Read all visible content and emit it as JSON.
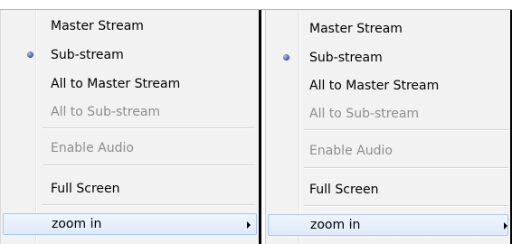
{
  "menus": [
    {
      "items": [
        {
          "label": "Master Stream",
          "enabled": true,
          "selected": false
        },
        {
          "label": "Sub-stream",
          "enabled": true,
          "selected": true
        },
        {
          "label": "All to Master Stream",
          "enabled": true,
          "selected": false
        },
        {
          "label": "All to Sub-stream",
          "enabled": false,
          "selected": false
        },
        {
          "label": "Enable Audio",
          "enabled": false,
          "selected": false
        },
        {
          "label": "Full Screen",
          "enabled": true,
          "selected": false
        },
        {
          "label": "zoom in",
          "enabled": true,
          "selected": false,
          "highlighted": true,
          "has_submenu": true
        }
      ]
    },
    {
      "items": [
        {
          "label": "Master Stream",
          "enabled": true,
          "selected": false
        },
        {
          "label": "Sub-stream",
          "enabled": true,
          "selected": true
        },
        {
          "label": "All to Master Stream",
          "enabled": true,
          "selected": false
        },
        {
          "label": "All to Sub-stream",
          "enabled": false,
          "selected": false
        },
        {
          "label": "Enable Audio",
          "enabled": false,
          "selected": false
        },
        {
          "label": "Full Screen",
          "enabled": true,
          "selected": false
        },
        {
          "label": "zoom in",
          "enabled": true,
          "selected": false,
          "highlighted": true,
          "has_submenu": true
        }
      ]
    }
  ],
  "colors": {
    "menu_background": "#f2f2f2",
    "disabled_text": "#8d8d8d",
    "highlight_border": "#a9c7ea",
    "radio_dot": "#4f63b8"
  }
}
